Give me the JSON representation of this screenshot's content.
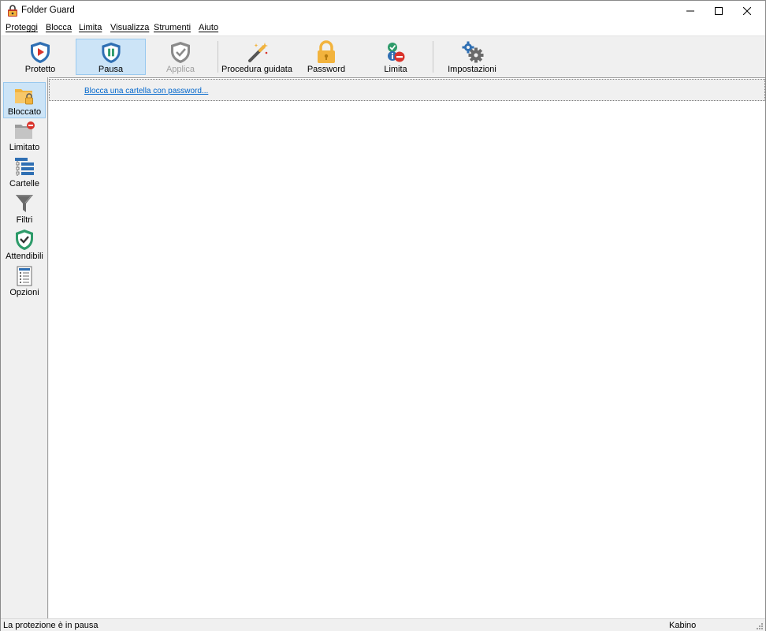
{
  "window": {
    "title": "Folder Guard"
  },
  "menu": {
    "items": [
      "Proteggi",
      "Blocca",
      "Limita",
      "Visualizza",
      "Strumenti",
      "Aiuto"
    ]
  },
  "toolbar": {
    "buttons": [
      {
        "label": "Protetto",
        "icon": "shield-play-icon"
      },
      {
        "label": "Pausa",
        "icon": "shield-pause-icon",
        "active": true
      },
      {
        "label": "Applica",
        "icon": "shield-check-icon",
        "disabled": true
      },
      {
        "label": "Procedura guidata",
        "icon": "magic-wand-icon"
      },
      {
        "label": "Password",
        "icon": "padlock-icon"
      },
      {
        "label": "Limita",
        "icon": "limit-icon"
      },
      {
        "label": "Impostazioni",
        "icon": "gears-icon"
      }
    ]
  },
  "sidebar": {
    "items": [
      {
        "label": "Bloccato",
        "icon": "locked-folder-icon",
        "active": true
      },
      {
        "label": "Limitato",
        "icon": "restricted-folder-icon"
      },
      {
        "label": "Cartelle",
        "icon": "folder-tree-icon"
      },
      {
        "label": "Filtri",
        "icon": "filter-icon"
      },
      {
        "label": "Attendibili",
        "icon": "trusted-shield-icon"
      },
      {
        "label": "Opzioni",
        "icon": "options-list-icon"
      }
    ]
  },
  "main": {
    "link": "Blocca una cartella con password..."
  },
  "status": {
    "left": "La protezione è in pausa",
    "right": "Kabino"
  },
  "colors": {
    "accent": "#cce4f7",
    "accent_border": "#99c9ef",
    "link": "#0066cc",
    "shield_blue": "#2f6fb3",
    "shield_green": "#2e9b6a",
    "lock_orange": "#f2b33d",
    "limit_red": "#d9332b"
  }
}
